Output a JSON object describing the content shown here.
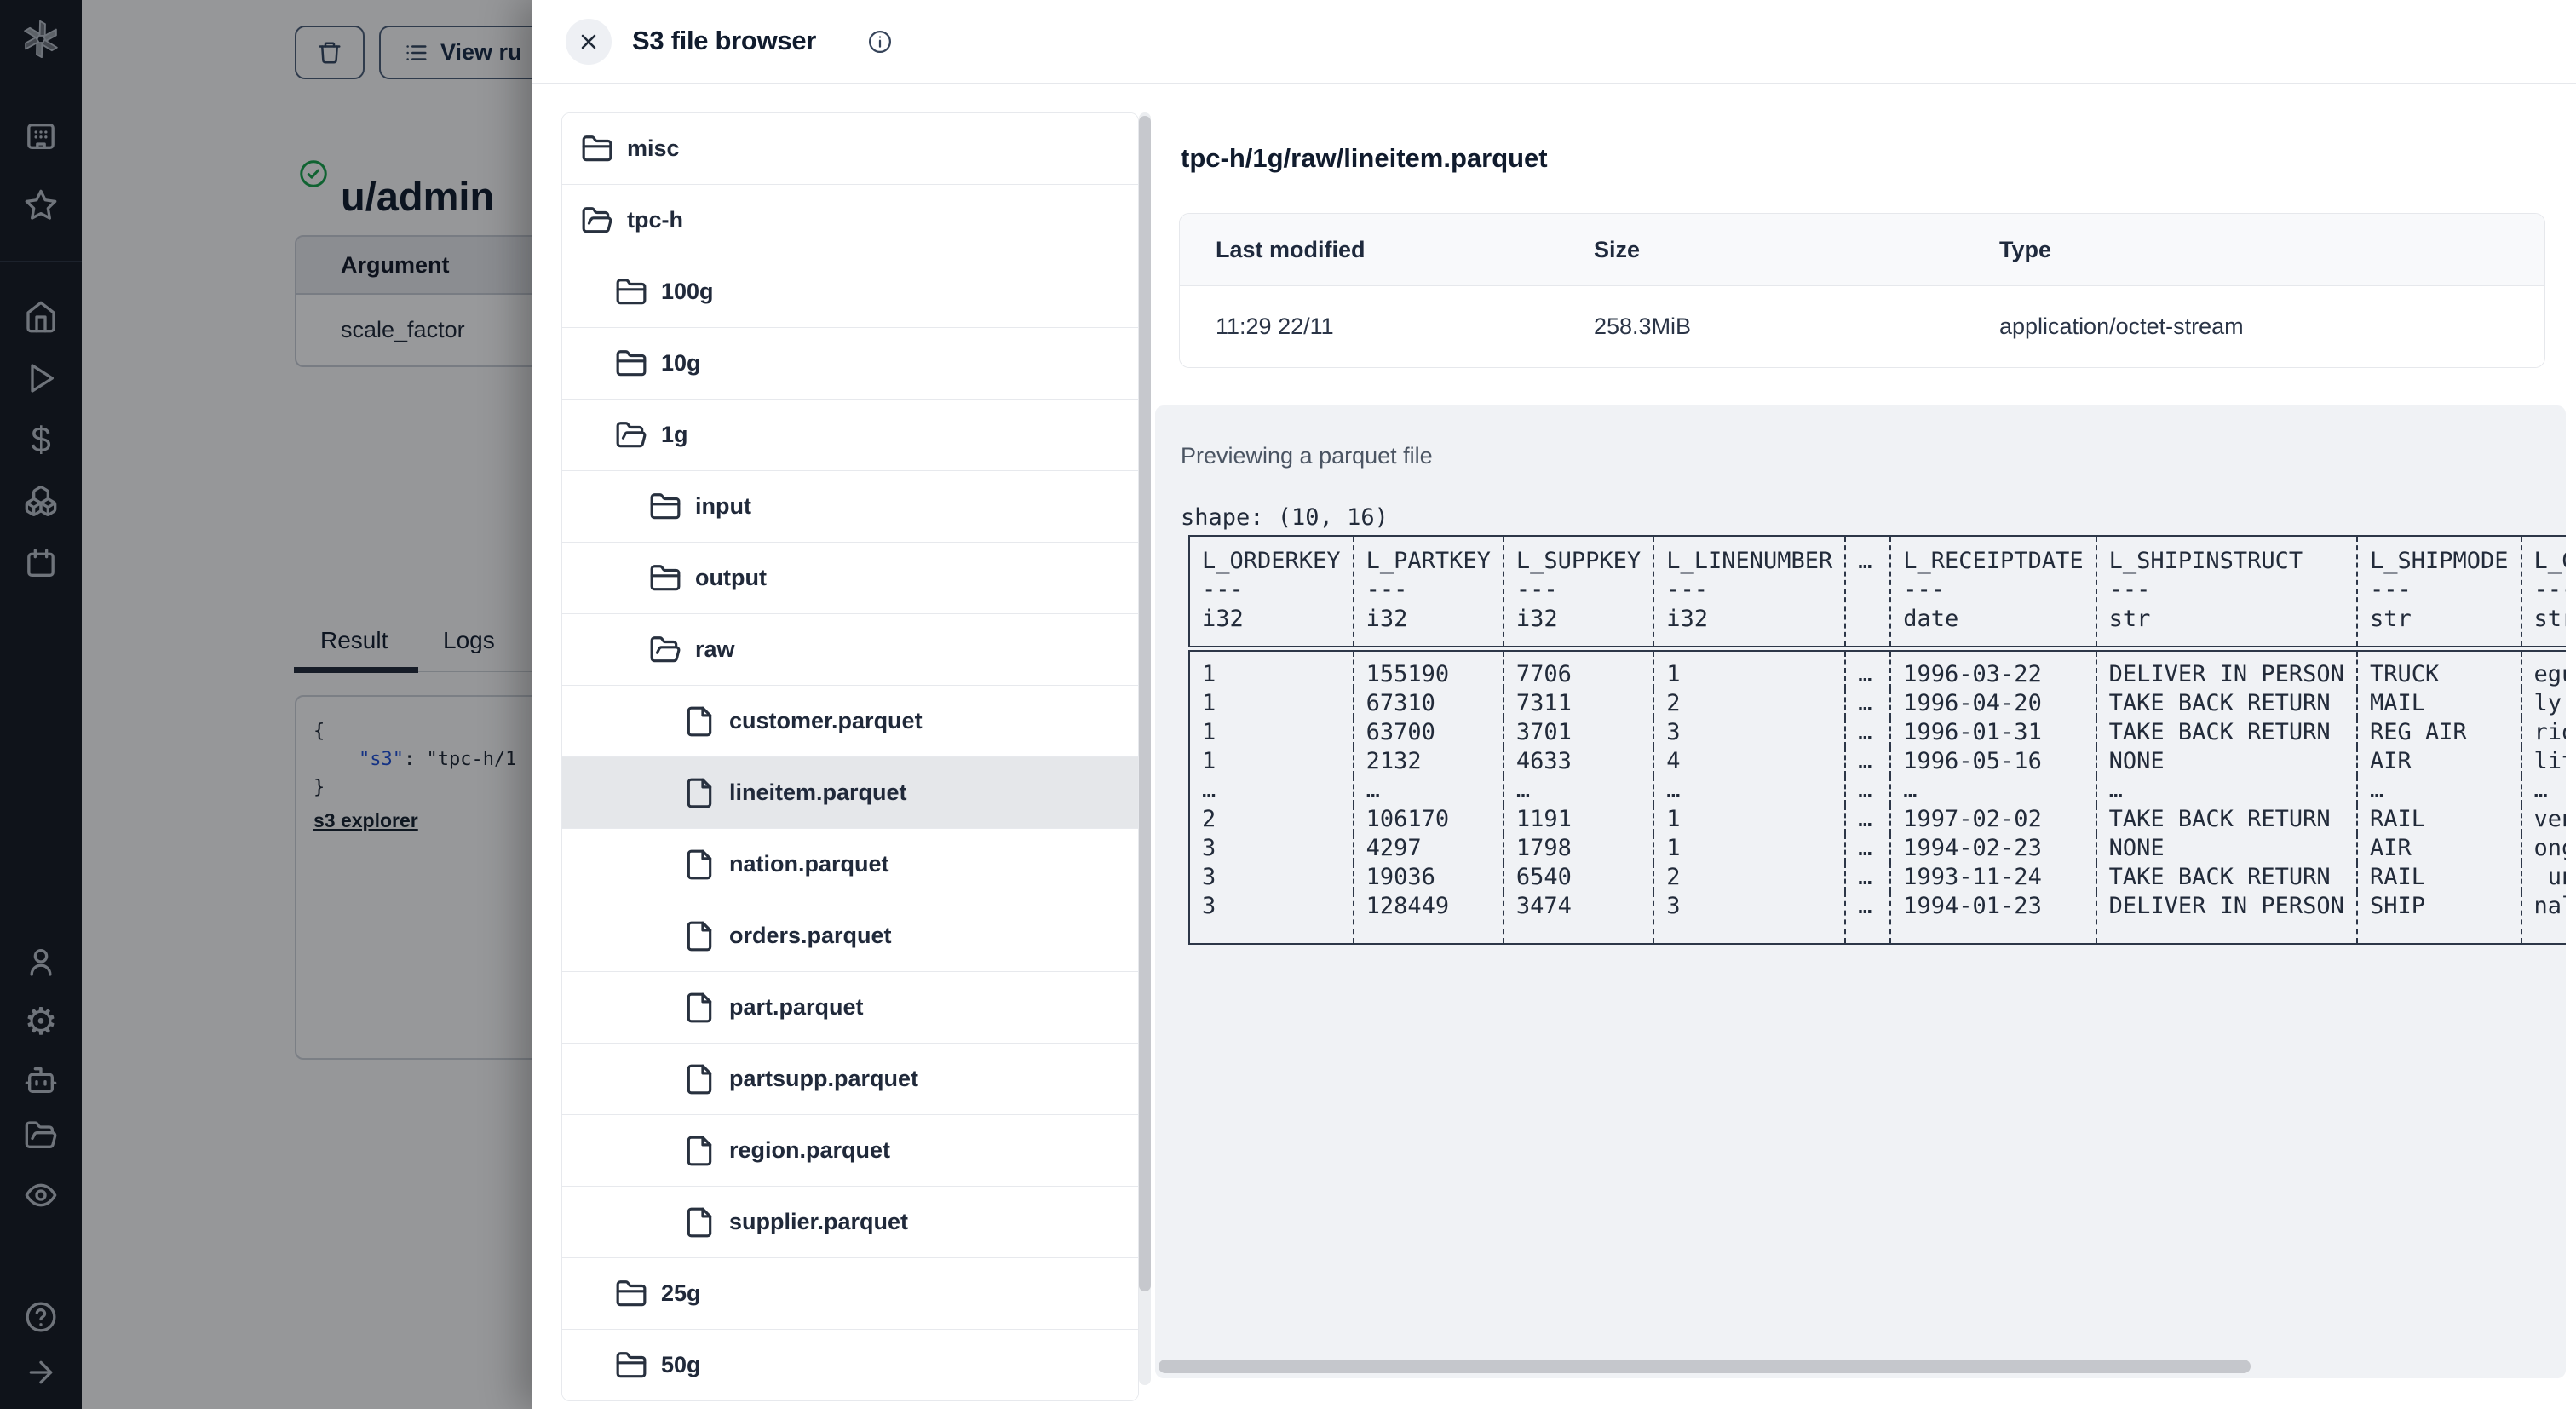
{
  "sidebar": {
    "icons": [
      "windmill-logo",
      "workspace-icon",
      "favorites-star-icon",
      "home-icon",
      "runs-play-icon",
      "variables-dollar-icon",
      "resources-cubes-icon",
      "schedules-calendar-icon",
      "user-icon",
      "settings-gear-icon",
      "workers-robot-icon",
      "folders-icon",
      "audit-eye-icon",
      "help-icon",
      "expand-arrow-icon"
    ]
  },
  "background": {
    "toolbar": {
      "view_runs_label": "View ru"
    },
    "page_title": "u/admin",
    "args_table": {
      "header": "Argument",
      "row": "scale_factor"
    },
    "tabs": {
      "result": "Result",
      "logs": "Logs"
    },
    "result_json": {
      "line_open": "{",
      "indent": "    ",
      "key": "\"s3\"",
      "separator": ": ",
      "value": "\"tpc-h/1",
      "line_close": "}"
    },
    "result_link": "s3 explorer"
  },
  "modal": {
    "title": "S3 file browser",
    "tree": {
      "items": [
        {
          "label": "misc",
          "icon": "folder",
          "level": 0,
          "selected": false
        },
        {
          "label": "tpc-h",
          "icon": "folder-open",
          "level": 0,
          "selected": false
        },
        {
          "label": "100g",
          "icon": "folder",
          "level": 1,
          "selected": false
        },
        {
          "label": "10g",
          "icon": "folder",
          "level": 1,
          "selected": false
        },
        {
          "label": "1g",
          "icon": "folder-open",
          "level": 1,
          "selected": false
        },
        {
          "label": "input",
          "icon": "folder",
          "level": 2,
          "selected": false
        },
        {
          "label": "output",
          "icon": "folder",
          "level": 2,
          "selected": false
        },
        {
          "label": "raw",
          "icon": "folder-open",
          "level": 2,
          "selected": false
        },
        {
          "label": "customer.parquet",
          "icon": "file",
          "level": 3,
          "selected": false
        },
        {
          "label": "lineitem.parquet",
          "icon": "file",
          "level": 3,
          "selected": true
        },
        {
          "label": "nation.parquet",
          "icon": "file",
          "level": 3,
          "selected": false
        },
        {
          "label": "orders.parquet",
          "icon": "file",
          "level": 3,
          "selected": false
        },
        {
          "label": "part.parquet",
          "icon": "file",
          "level": 3,
          "selected": false
        },
        {
          "label": "partsupp.parquet",
          "icon": "file",
          "level": 3,
          "selected": false
        },
        {
          "label": "region.parquet",
          "icon": "file",
          "level": 3,
          "selected": false
        },
        {
          "label": "supplier.parquet",
          "icon": "file",
          "level": 3,
          "selected": false
        },
        {
          "label": "25g",
          "icon": "folder",
          "level": 1,
          "selected": false
        },
        {
          "label": "50g",
          "icon": "folder",
          "level": 1,
          "selected": false
        }
      ]
    },
    "file_details": {
      "path": "tpc-h/1g/raw/lineitem.parquet",
      "meta_headers": [
        "Last modified",
        "Size",
        "Type"
      ],
      "meta_values": [
        "11:29 22/11",
        "258.3MiB",
        "application/octet-stream"
      ],
      "preview_label": "Previewing a parquet file",
      "shape_text": "shape: (10, 16)",
      "preview_table": {
        "columns": [
          {
            "name": "L_ORDERKEY",
            "sep": "---",
            "dtype": "i32"
          },
          {
            "name": "L_PARTKEY",
            "sep": "---",
            "dtype": "i32"
          },
          {
            "name": "L_SUPPKEY",
            "sep": "---",
            "dtype": "i32"
          },
          {
            "name": "L_LINENUMBER",
            "sep": "---",
            "dtype": "i32"
          },
          {
            "name": "…",
            "sep": "",
            "dtype": ""
          },
          {
            "name": "L_RECEIPTDATE",
            "sep": "---",
            "dtype": "date"
          },
          {
            "name": "L_SHIPINSTRUCT",
            "sep": "---",
            "dtype": "str"
          },
          {
            "name": "L_SHIPMODE",
            "sep": "---",
            "dtype": "str"
          },
          {
            "name": "L_CO",
            "sep": "---",
            "dtype": "str"
          }
        ],
        "rows": [
          [
            "1",
            "155190",
            "7706",
            "1",
            "…",
            "1996-03-22",
            "DELIVER IN PERSON",
            "TRUCK",
            "egul"
          ],
          [
            "1",
            "67310",
            "7311",
            "2",
            "…",
            "1996-04-20",
            "TAKE BACK RETURN",
            "MAIL",
            "ly f"
          ],
          [
            "1",
            "63700",
            "3701",
            "3",
            "…",
            "1996-01-31",
            "TAKE BACK RETURN",
            "REG AIR",
            "riou"
          ],
          [
            "1",
            "2132",
            "4633",
            "4",
            "…",
            "1996-05-16",
            "NONE",
            "AIR",
            "lite"
          ],
          [
            "…",
            "…",
            "…",
            "…",
            "…",
            "…",
            "…",
            "…",
            "…"
          ],
          [
            "2",
            "106170",
            "1191",
            "1",
            "…",
            "1997-02-02",
            "TAKE BACK RETURN",
            "RAIL",
            "ven"
          ],
          [
            "3",
            "4297",
            "1798",
            "1",
            "…",
            "1994-02-23",
            "NONE",
            "AIR",
            "ongs"
          ],
          [
            "3",
            "19036",
            "6540",
            "2",
            "…",
            "1993-11-24",
            "TAKE BACK RETURN",
            "RAIL",
            " unu"
          ],
          [
            "3",
            "128449",
            "3474",
            "3",
            "…",
            "1994-01-23",
            "DELIVER IN PERSON",
            "SHIP",
            "nal"
          ]
        ]
      }
    }
  },
  "colors": {
    "accent_blue": "#1d4ed8",
    "success_green": "#16a34a",
    "sidebar_bg": "#141922",
    "table_border": "#2d3748"
  }
}
